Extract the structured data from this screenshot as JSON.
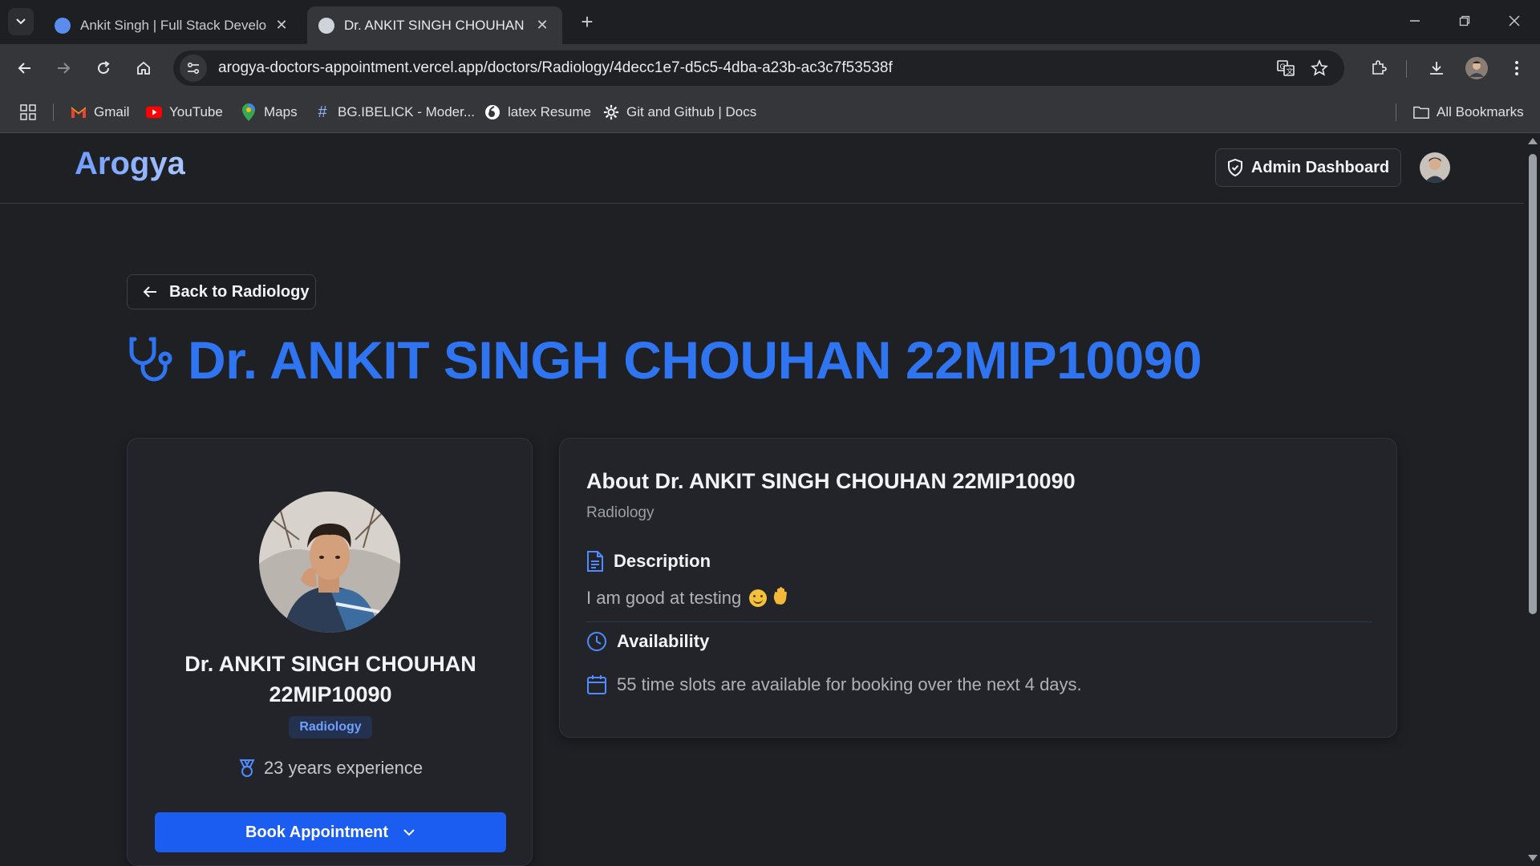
{
  "browser": {
    "tabs": [
      {
        "title": "Ankit Singh | Full Stack Develop"
      },
      {
        "title": "Dr. ANKIT SINGH CHOUHAN 22"
      }
    ],
    "url": "arogya-doctors-appointment.vercel.app/doctors/Radiology/4decc1e7-d5c5-4dba-a23b-ac3c7f53538f",
    "bookmarks": [
      {
        "label": "Gmail",
        "icon": "gmail-icon"
      },
      {
        "label": "YouTube",
        "icon": "youtube-icon"
      },
      {
        "label": "Maps",
        "icon": "maps-icon"
      },
      {
        "label": "BG.IBELICK - Moder...",
        "icon": "hash-icon"
      },
      {
        "label": "latex Resume",
        "icon": "overleaf-icon"
      },
      {
        "label": "Git and Github | Docs",
        "icon": "gear-icon"
      }
    ],
    "all_bookmarks_label": "All Bookmarks"
  },
  "header": {
    "logo": "Arogya",
    "admin_button_label": "Admin Dashboard"
  },
  "page": {
    "back_button_label": "Back to Radiology",
    "heading": "Dr. ANKIT SINGH CHOUHAN 22MIP10090"
  },
  "profile": {
    "name": "Dr. ANKIT SINGH CHOUHAN 22MIP10090",
    "specialty": "Radiology",
    "experience": "23 years experience",
    "book_button_label": "Book Appointment"
  },
  "about": {
    "title": "About Dr. ANKIT SINGH CHOUHAN 22MIP10090",
    "specialty": "Radiology",
    "description_heading": "Description",
    "description_text": "I am good at testing",
    "availability_heading": "Availability",
    "availability_text": "55 time slots are available for booking over the next 4 days."
  },
  "colors": {
    "accent": "#2f74f0",
    "button": "#1a5df0",
    "background": "#1f2024",
    "card": "#232429"
  }
}
